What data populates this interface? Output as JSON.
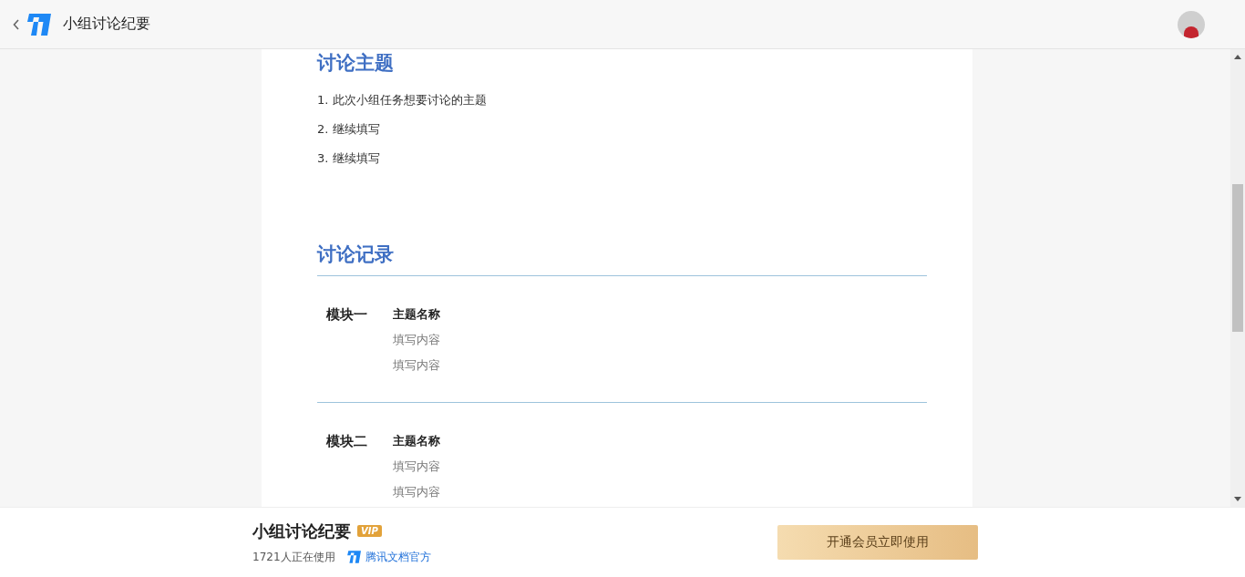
{
  "header": {
    "title": "小组讨论纪要"
  },
  "document": {
    "sections": [
      {
        "heading": "讨论主题",
        "kind": "list",
        "items": [
          "1. 此次小组任务想要讨论的主题",
          "2. 继续填写",
          "3. 继续填写"
        ]
      },
      {
        "heading": "讨论记录",
        "kind": "modules",
        "modules": [
          {
            "label": "模块一",
            "title": "主题名称",
            "lines": [
              "填写内容",
              "填写内容"
            ]
          },
          {
            "label": "模块二",
            "title": "主题名称",
            "lines": [
              "填写内容",
              "填写内容"
            ]
          }
        ]
      }
    ]
  },
  "footer": {
    "title": "小组讨论纪要",
    "badge": "VIP",
    "usage": "1721人正在使用",
    "author": "腾讯文档官方",
    "button": "开通会员立即使用"
  }
}
